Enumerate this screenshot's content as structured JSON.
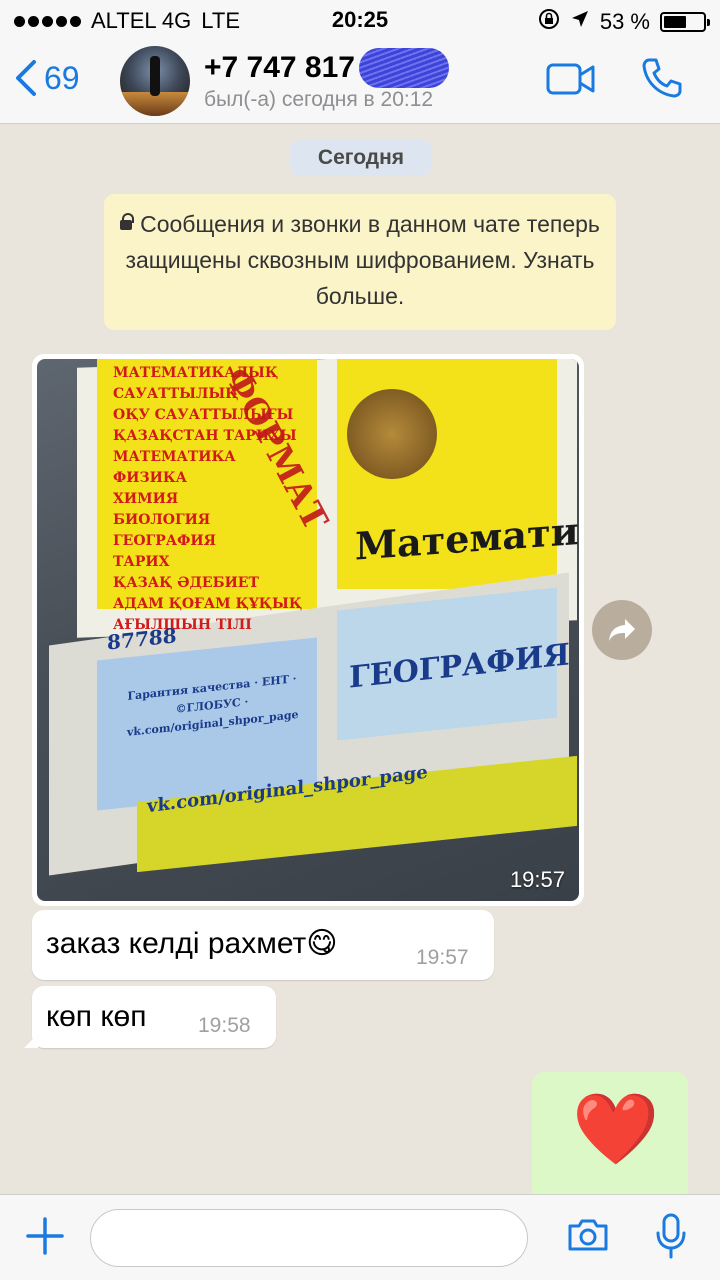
{
  "status_bar": {
    "carrier": "ALTEL 4G",
    "network": "LTE",
    "time": "20:25",
    "battery": "53 %"
  },
  "header": {
    "back_count": "69",
    "contact_name": "+7 747 817",
    "last_seen": "был(-а) сегодня в 20:12"
  },
  "chat": {
    "date_label": "Сегодня",
    "encryption_notice": "Сообщения и звонки в данном чате теперь защищены сквозным шифрованием. Узнать больше.",
    "image_message": {
      "time": "19:57",
      "visible_text": {
        "title_top": "Математика",
        "title_bottom": "ГЕОГРАФИЯ",
        "cover_word": "ФОРМАТ",
        "list": [
          "МАТЕМАТИКАЛЫҚ",
          "САУАТТЫЛЫҚ",
          "ОҚУ САУАТТЫЛЫҒЫ",
          "ҚАЗАҚСТАН ТАРИХЫ",
          "МАТЕМАТИКА",
          "ФИЗИКА",
          "ХИМИЯ",
          "БИОЛОГИЯ",
          "ГЕОГРАФИЯ",
          "ТАРИХ",
          "ҚАЗАҚ ӘДЕБИЕТ",
          "АДАМ ҚОҒАМ ҚҰҚЫҚ",
          "АҒЫЛШЫН ТІЛІ"
        ],
        "stamp": "Гарантия качества · ЕНТ · ©ГЛОБУС · vk.com/original_shpor_page",
        "url": "vk.com/original_shpor_page",
        "phone_partial": "87788"
      }
    },
    "messages": [
      {
        "text": "заказ келді рахмет😋",
        "time": "19:57"
      },
      {
        "text": "көп көп",
        "time": "19:58"
      }
    ],
    "outgoing_emoji": "❤️"
  },
  "input_bar": {
    "placeholder": ""
  },
  "colors": {
    "accent": "#1a7ae0",
    "chat_bg": "#e9e4dc",
    "outgoing_bubble": "#dcf8c6",
    "notice_bg": "#fbf4c9"
  }
}
